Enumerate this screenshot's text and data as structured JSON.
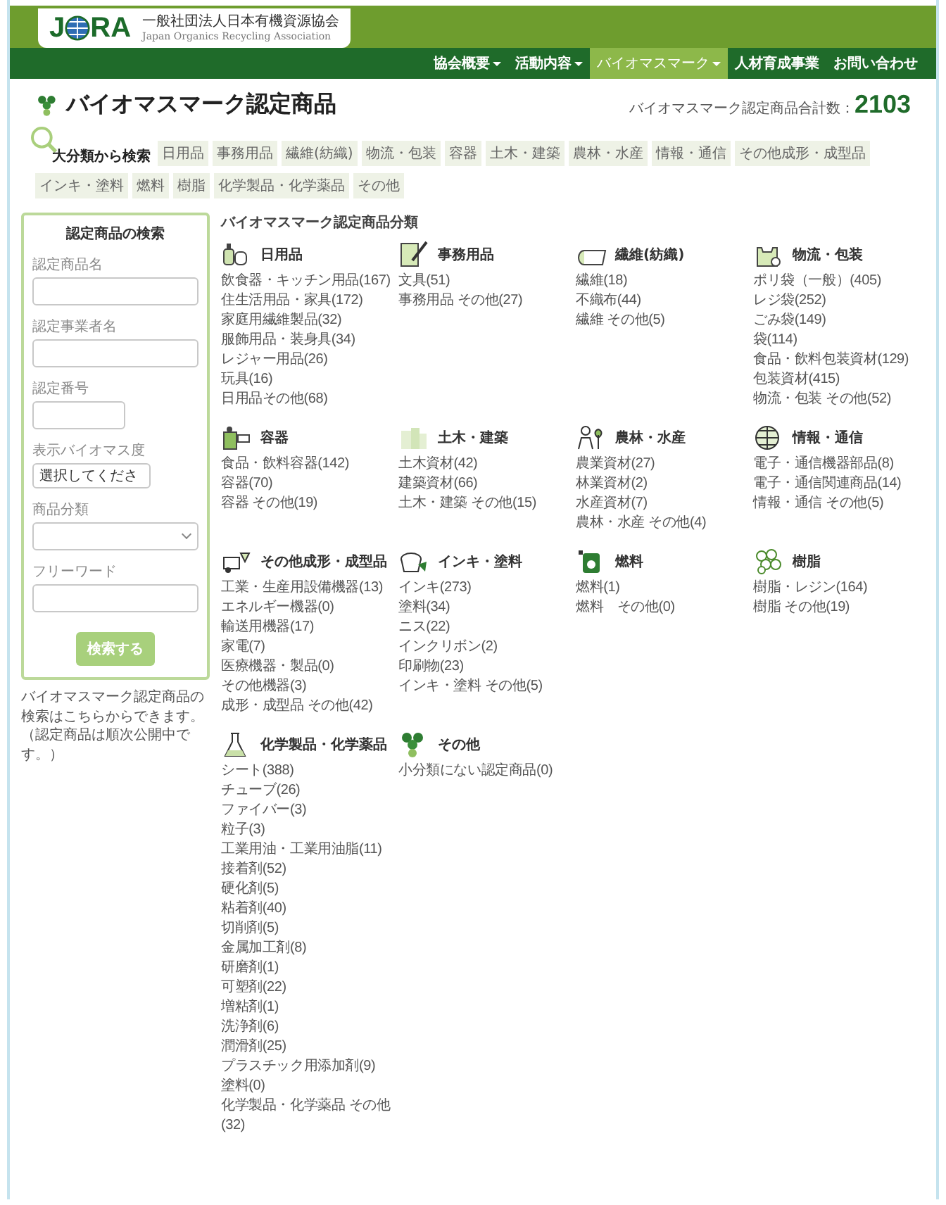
{
  "header": {
    "logo": {
      "before": "J",
      "after": "RA"
    },
    "org_name": "一般社団法人日本有機資源協会",
    "org_name_en": "Japan Organics Recycling Association"
  },
  "nav": [
    {
      "label": "協会概要",
      "dropdown": true,
      "selected": false
    },
    {
      "label": "活動内容",
      "dropdown": true,
      "selected": false
    },
    {
      "label": "バイオマスマーク",
      "dropdown": true,
      "selected": true
    },
    {
      "label": "人材育成事業",
      "dropdown": false,
      "selected": false
    },
    {
      "label": "お問い合わせ",
      "dropdown": false,
      "selected": false
    }
  ],
  "page_title": "バイオマスマーク認定商品",
  "total": {
    "label": "バイオマスマーク認定商品合計数：",
    "value": "2103"
  },
  "category_bar": {
    "label": "大分類から検索",
    "links": [
      "日用品",
      "事務用品",
      "繊維(紡織)",
      "物流・包装",
      "容器",
      "土木・建築",
      "農林・水産",
      "情報・通信",
      "その他成形・成型品",
      "インキ・塗料",
      "燃料",
      "樹脂",
      "化学製品・化学薬品",
      "その他"
    ]
  },
  "search_panel": {
    "title": "認定商品の検索",
    "fields": [
      {
        "label": "認定商品名",
        "kind": "text"
      },
      {
        "label": "認定事業者名",
        "kind": "text"
      },
      {
        "label": "認定番号",
        "kind": "number"
      },
      {
        "label": "表示バイオマス度",
        "kind": "picker",
        "value": "選択してくださ"
      },
      {
        "label": "商品分類",
        "kind": "select"
      },
      {
        "label": "フリーワード",
        "kind": "text"
      }
    ],
    "button": {
      "label": "検索する",
      "disabled": true
    },
    "note": "バイオマスマーク認定商品の検索はこちらからできます。（認定商品は順次公開中です。）"
  },
  "classification": {
    "heading": "バイオマスマーク認定商品分類",
    "categories": [
      {
        "name": "日用品",
        "kind": "jars",
        "items": [
          "飲食器・キッチン用品(167)",
          "住生活用品・家具(172)",
          "家庭用繊維製品(32)",
          "服飾用品・装身具(34)",
          "レジャー用品(26)",
          "玩具(16)",
          "日用品その他(68)"
        ]
      },
      {
        "name": "事務用品",
        "kind": "pen",
        "items": [
          "文具(51)",
          "事務用品 その他(27)"
        ]
      },
      {
        "name": "繊維(紡織)",
        "kind": "fabric",
        "items": [
          "繊維(18)",
          "不織布(44)",
          "繊維 その他(5)"
        ]
      },
      {
        "name": "物流・包装",
        "kind": "bag",
        "items": [
          "ポリ袋（一般）(405)",
          "レジ袋(252)",
          "ごみ袋(149)",
          "袋(114)",
          "食品・飲料包装資材(129)",
          "包装資材(415)",
          "物流・包装 その他(52)"
        ]
      },
      {
        "name": "容器",
        "kind": "box",
        "items": [
          "食品・飲料容器(142)",
          "容器(70)",
          "容器 その他(19)"
        ]
      },
      {
        "name": "土木・建築",
        "kind": "building",
        "items": [
          "土木資材(42)",
          "建築資材(66)",
          "土木・建築 その他(15)"
        ]
      },
      {
        "name": "農林・水産",
        "kind": "person",
        "items": [
          "農業資材(27)",
          "林業資材(2)",
          "水産資材(7)",
          "農林・水産 その他(4)"
        ]
      },
      {
        "name": "情報・通信",
        "kind": "globe",
        "items": [
          "電子・通信機器部品(8)",
          "電子・通信関連商品(14)",
          "情報・通信 その他(5)"
        ]
      },
      {
        "name": "その他成形・成型品",
        "kind": "cart",
        "items": [
          "工業・生産用設備機器(13)",
          "エネルギー機器(0)",
          "輸送用機器(17)",
          "家電(7)",
          "医療機器・製品(0)",
          "その他機器(3)",
          "成形・成型品 その他(42)"
        ]
      },
      {
        "name": "インキ・塗料",
        "kind": "pot",
        "items": [
          "インキ(273)",
          "塗料(34)",
          "ニス(22)",
          "インクリボン(2)",
          "印刷物(23)",
          "インキ・塗料 その他(5)"
        ]
      },
      {
        "name": "燃料",
        "kind": "can",
        "items": [
          "燃料(1)",
          "燃料　その他(0)"
        ]
      },
      {
        "name": "樹脂",
        "kind": "pellets",
        "items": [
          "樹脂・レジン(164)",
          "樹脂 その他(19)"
        ]
      },
      {
        "name": "化学製品・化学薬品",
        "kind": "flask",
        "items": [
          "シート(388)",
          "チューブ(26)",
          "ファイバー(3)",
          "粒子(3)",
          "工業用油・工業用油脂(11)",
          "接着剤(52)",
          "硬化剤(5)",
          "粘着剤(40)",
          "切削剤(5)",
          "金属加工剤(8)",
          "研磨剤(1)",
          "可塑剤(22)",
          "増粘剤(1)",
          "洗浄剤(6)",
          "潤滑剤(25)",
          "プラスチック用添加剤(9)",
          "塗料(0)",
          "化学製品・化学薬品 その他(32)"
        ]
      },
      {
        "name": "その他",
        "kind": "clover",
        "items": [
          "小分類にない認定商品(0)"
        ]
      }
    ]
  }
}
